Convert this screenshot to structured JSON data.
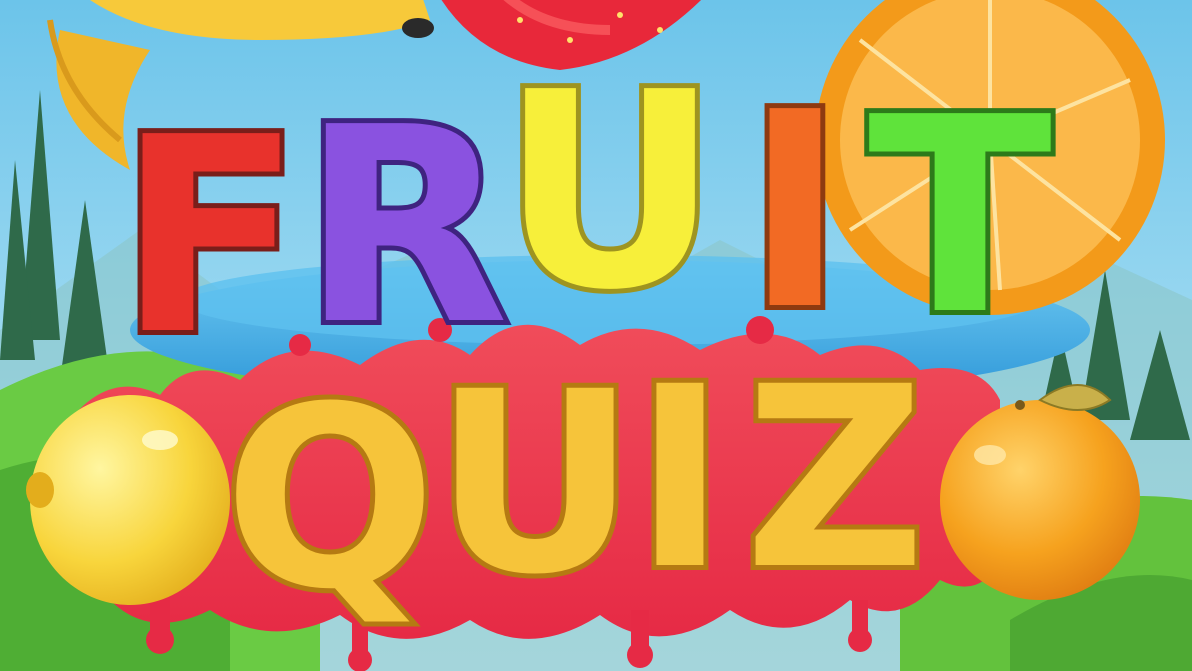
{
  "title": {
    "line1": {
      "letters": [
        "F",
        "R",
        "U",
        "I",
        "T"
      ],
      "colors": [
        "#e8322c",
        "#8a52e0",
        "#f7ef3a",
        "#f26a24",
        "#5fe33b"
      ]
    },
    "line2": {
      "letters": [
        "Q",
        "U",
        "I",
        "Z"
      ],
      "color": "#f6c43a"
    }
  },
  "colors": {
    "sky": "#8fd3ee",
    "hill_green": "#5cbf3c",
    "tree_dark": "#2f6a4a",
    "juice_splash": "#f03a4a",
    "plate_blue": "#4fb4e8",
    "orange": "#f5a21f",
    "lemon": "#f7d43a",
    "banana": "#f7c93a",
    "strawberry": "#e8283a"
  },
  "decorations": [
    "banana-icon",
    "strawberry-icon",
    "orange-slice-icon",
    "lemon-icon",
    "orange-icon",
    "juice-splash",
    "fruit-plate"
  ]
}
